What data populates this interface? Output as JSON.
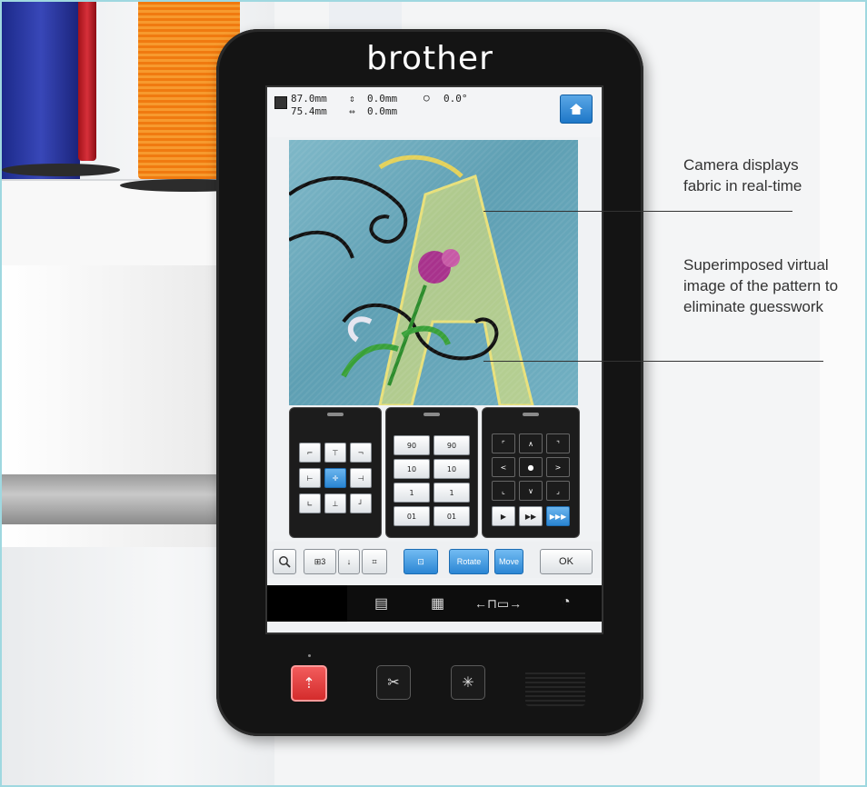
{
  "brand": {
    "logo_text": "brother"
  },
  "status": {
    "width_value": "87.0mm",
    "height_value": "75.4mm",
    "vertical_offset": "0.0mm",
    "horizontal_offset": "0.0mm",
    "rotation": "0.0°"
  },
  "rotate_panel": {
    "buttons": [
      "90",
      "90",
      "10",
      "10",
      "1",
      "1",
      "01",
      "01"
    ]
  },
  "toolbar": {
    "count_label": "3",
    "rotate_label": "Rotate",
    "move_label": "Move",
    "ok_label": "OK"
  },
  "annotations": {
    "camera_note": "Camera displays fabric in real-time",
    "superimposed_note": "Superimposed virtual image of the pattern to eliminate guesswork"
  },
  "colors": {
    "accent_blue": "#2a85d2",
    "frame_border": "#9fd8e0",
    "device_body": "#141414",
    "red_button": "#d42c2c"
  },
  "icons": [
    "home-icon",
    "zoom-icon",
    "frame-icon",
    "hoop-icon",
    "clock-icon",
    "scissors-icon",
    "needle-icon",
    "start-stop-icon"
  ]
}
